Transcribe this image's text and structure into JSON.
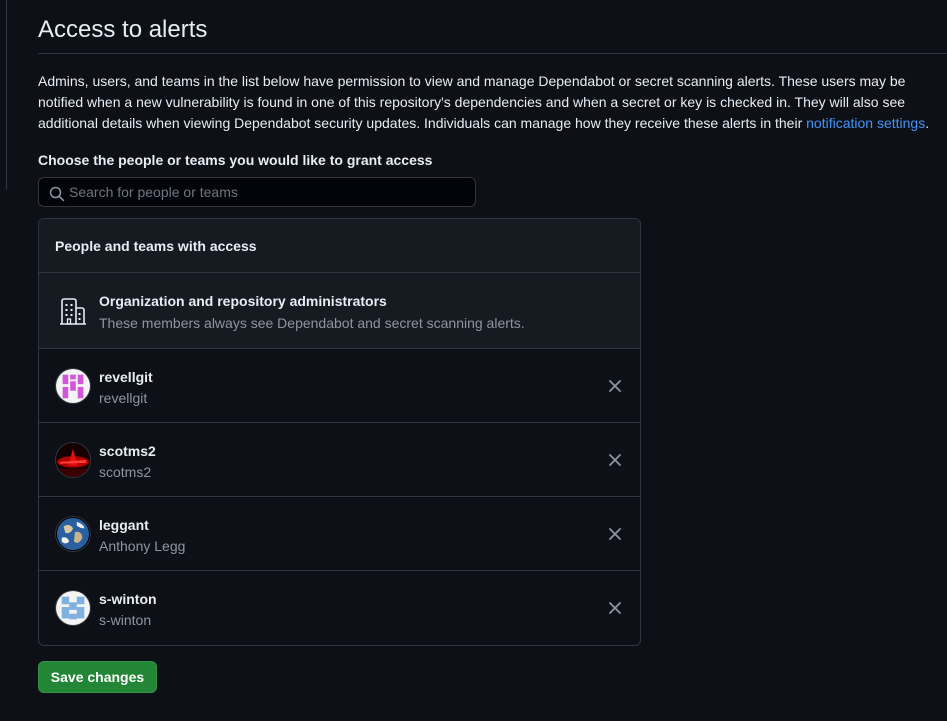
{
  "page": {
    "title": "Access to alerts",
    "description_text": "Admins, users, and teams in the list below have permission to view and manage Dependabot or secret scanning alerts. These users may be notified when a new vulnerability is found in one of this repository's dependencies and when a secret or key is checked in. They will also see additional details when viewing Dependabot security updates. Individuals can manage how they receive these alerts in their ",
    "description_link": "notification settings",
    "description_end": "."
  },
  "grant": {
    "label": "Choose the people or teams you would like to grant access",
    "search_placeholder": "Search for people or teams",
    "search_value": ""
  },
  "access_list": {
    "header": "People and teams with access",
    "admins": {
      "title": "Organization and repository administrators",
      "subtitle": "These members always see Dependabot and secret scanning alerts.",
      "icon": "organization-icon"
    },
    "users": [
      {
        "login": "revellgit",
        "name": "revellgit"
      },
      {
        "login": "scotms2",
        "name": "scotms2"
      },
      {
        "login": "leggant",
        "name": "Anthony Legg"
      },
      {
        "login": "s-winton",
        "name": "s-winton"
      }
    ]
  },
  "actions": {
    "save_label": "Save changes"
  },
  "colors": {
    "background": "#0d1117",
    "border": "#30363d",
    "link": "#4493f8",
    "save_button": "#238636",
    "muted_text": "#8d96a0"
  }
}
